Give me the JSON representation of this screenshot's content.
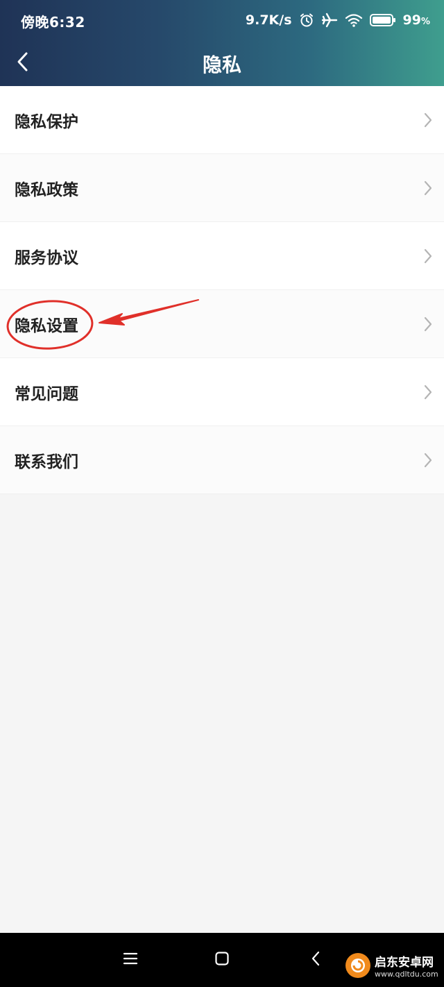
{
  "status_bar": {
    "time": "傍晚6:32",
    "net_speed": "9.7K/s",
    "battery_percent": "99",
    "battery_unit": "%",
    "icons": [
      "alarm-icon",
      "airplane-icon",
      "wifi-icon",
      "battery-icon"
    ]
  },
  "header": {
    "title": "隐私",
    "back_icon": "chevron-left-icon"
  },
  "menu": {
    "items": [
      {
        "label": "隐私保护"
      },
      {
        "label": "隐私政策"
      },
      {
        "label": "服务协议"
      },
      {
        "label": "隐私设置"
      },
      {
        "label": "常见问题"
      },
      {
        "label": "联系我们"
      }
    ]
  },
  "annotation": {
    "highlighted_item": "隐私设置",
    "color": "#e0302a"
  },
  "nav_bar": {
    "icons": [
      "menu-icon",
      "home-icon",
      "back-icon"
    ]
  },
  "watermark": {
    "name": "启东安卓网",
    "url": "www.qdltdu.com"
  },
  "colors": {
    "header_start": "#1f3356",
    "header_end": "#3f9e8e",
    "background": "#f5f5f5",
    "item_text": "#222222",
    "chevron": "#b4b4b4"
  }
}
